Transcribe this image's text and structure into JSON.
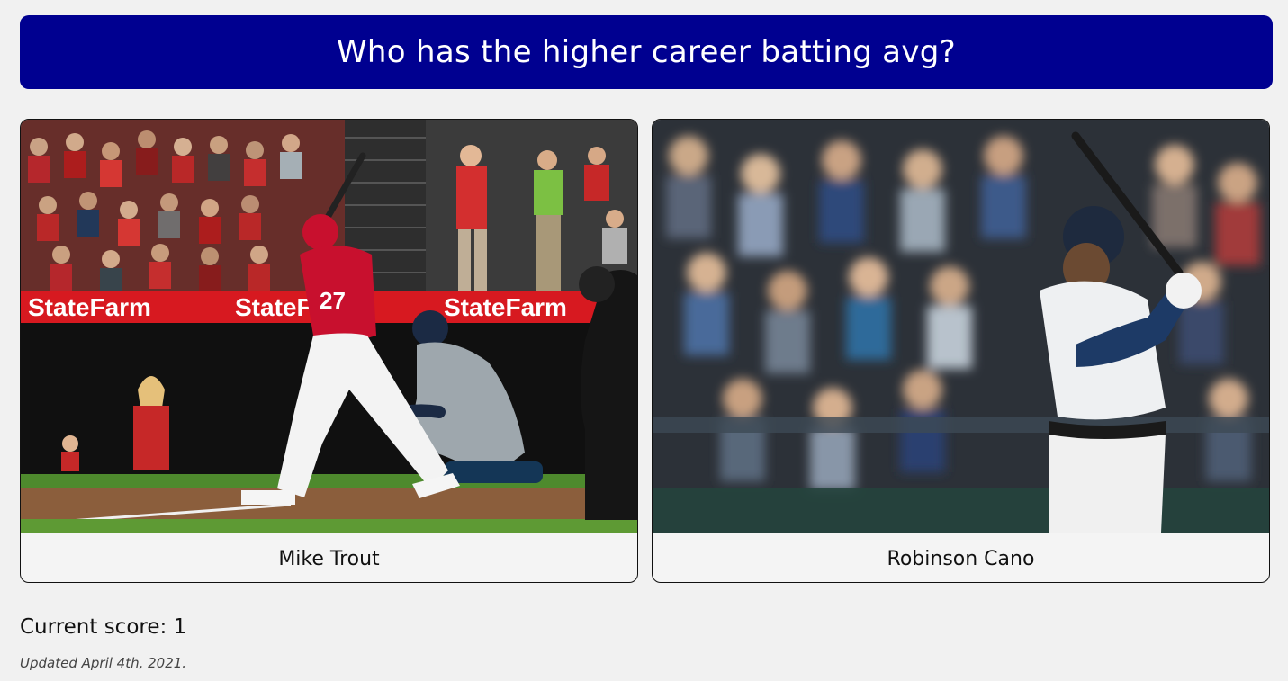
{
  "question": {
    "text": "Who has the higher career batting avg?"
  },
  "choices": [
    {
      "name": "Mike Trout",
      "photo_icon": "batter-swing-photo",
      "banner_text": "StateFarm",
      "jersey_number": "27"
    },
    {
      "name": "Robinson Cano",
      "photo_icon": "batter-stance-photo"
    }
  ],
  "score": {
    "text": "Current score: 1"
  },
  "footer": {
    "updated_text": "Updated April 4th, 2021."
  },
  "colors": {
    "banner": "#000090",
    "background": "#f1f1f1",
    "angels_red": "#c8102e",
    "mariners_navy": "#0c2c56"
  }
}
